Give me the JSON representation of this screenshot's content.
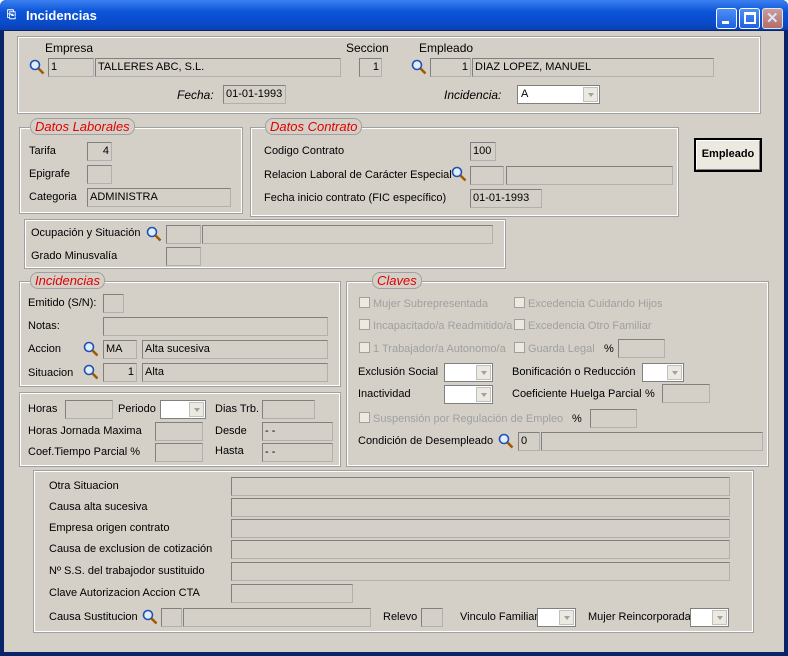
{
  "window": {
    "title": "Incidencias"
  },
  "top": {
    "empresa_label": "Empresa",
    "seccion_label": "Seccion",
    "empleado_label": "Empleado",
    "empresa_code": "1",
    "empresa_name": "TALLERES ABC, S.L.",
    "seccion_value": "1",
    "empleado_code": "1",
    "empleado_name": "DIAZ  LOPEZ, MANUEL",
    "fecha_label": "Fecha:",
    "fecha_value": "01-01-1993",
    "incidencia_label": "Incidencia:",
    "incidencia_value": "A"
  },
  "laborales": {
    "legend": "Datos Laborales",
    "tarifa_label": "Tarifa",
    "tarifa_value": "4",
    "epigrafe_label": "Epigrafe",
    "epigrafe_value": "",
    "categoria_label": "Categoria",
    "categoria_value": "ADMINISTRA"
  },
  "contrato": {
    "legend": "Datos Contrato",
    "codigo_label": "Codigo Contrato",
    "codigo_value": "100",
    "relacion_label": "Relacion Laboral de Carácter Especial",
    "fic_label": "Fecha inicio  contrato (FIC específico)",
    "fic_value": "01-01-1993"
  },
  "empleado_button": "Empleado",
  "ocupacion": {
    "ocupacion_label": "Ocupación y Situación",
    "minusvalia_label": "Grado Minusvalía"
  },
  "incidencias": {
    "legend": "Incidencias",
    "emitido_label": "Emitido (S/N):",
    "notas_label": "Notas:",
    "accion_label": "Accion",
    "accion_code": "MA",
    "accion_desc": "Alta sucesiva",
    "situacion_label": "Situacion",
    "situacion_code": "1",
    "situacion_desc": "Alta"
  },
  "horas": {
    "horas_label": "Horas",
    "periodo_label": "Periodo",
    "dias_label": "Dias Trb.",
    "jornada_label": "Horas Jornada Maxima",
    "desde_label": "Desde",
    "desde_value": "- -",
    "coef_label": "Coef.Tiempo Parcial %",
    "hasta_label": "Hasta",
    "hasta_value": "- -"
  },
  "claves": {
    "legend": "Claves",
    "mujer": "Mujer Subrepresentada",
    "excedencia_hijos": "Excedencia Cuidando Hijos",
    "incapacitado": "Incapacitado/a Readmitido/a",
    "excedencia_familiar": "Excedencia Otro Familiar",
    "autonomo": "1 Trabajador/a Autonomo/a",
    "guarda": "Guarda Legal",
    "pct1": "%",
    "exclusion_label": "Exclusión Social",
    "bonificacion_label": "Bonificación o Reducción",
    "inactividad_label": "Inactividad",
    "huelga_label": "Coeficiente Huelga Parcial",
    "pct2": "%",
    "suspension": "Suspensión por Regulación de Empleo",
    "pct3": "%",
    "desempleado_label": "Condición de Desempleado",
    "desempleado_value": "0"
  },
  "bottom": {
    "otra_situacion": "Otra Situacion",
    "causa_alta": "Causa alta sucesiva",
    "empresa_origen": "Empresa origen contrato",
    "causa_exclusion": "Causa de exclusion de cotización",
    "nss": "Nº S.S. del trabajodor sustituido",
    "clave_autorizacion": "Clave Autorizacion Accion CTA",
    "causa_sustitucion": "Causa Sustitucion",
    "relevo": "Relevo",
    "vinculo": "Vinculo Familiar",
    "mujer_reincorporada": "Mujer Reincorporada"
  }
}
